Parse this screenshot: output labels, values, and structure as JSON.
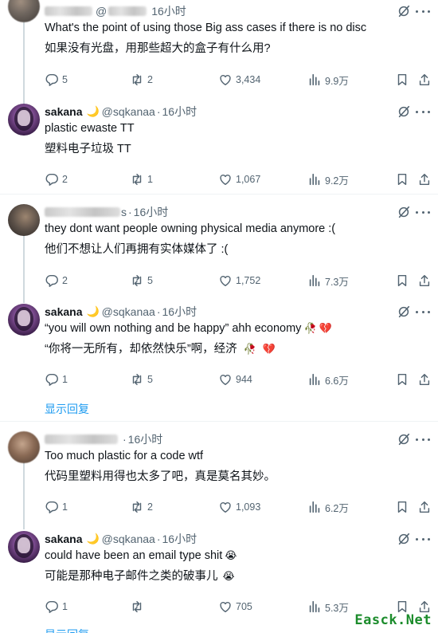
{
  "posts": [
    {
      "handle_visible": "@",
      "time": "16小时",
      "text_en": "What's the point of using those Big ass cases if there is no disc",
      "text_zh": "如果没有光盘，用那些超大的盒子有什么用?",
      "replies": "5",
      "reposts": "2",
      "likes": "3,434",
      "views": "9.9万"
    },
    {
      "name": "sakana",
      "handle": "@sqkanaa",
      "time": "16小时",
      "text_en": "plastic ewaste TT",
      "text_zh": "塑料电子垃圾 TT",
      "replies": "2",
      "reposts": "1",
      "likes": "1,067",
      "views": "9.2万"
    },
    {
      "handle_visible": "s",
      "time": "16小时",
      "text_en": "they dont want people owning physical media anymore :(",
      "text_zh": "他们不想让人们再拥有实体媒体了 :(",
      "replies": "2",
      "reposts": "5",
      "likes": "1,752",
      "views": "7.3万"
    },
    {
      "name": "sakana",
      "handle": "@sqkanaa",
      "time": "16小时",
      "text_en": "“you will own nothing and be happy” ahh economy",
      "text_zh": "“你将一无所有，却依然快乐”啊，经济",
      "replies": "1",
      "reposts": "5",
      "likes": "944",
      "views": "6.6万"
    },
    {
      "handle_visible": "",
      "time": "16小时",
      "text_en": "Too much plastic for a code wtf",
      "text_zh": "代码里塑料用得也太多了吧，真是莫名其妙。",
      "replies": "1",
      "reposts": "2",
      "likes": "1,093",
      "views": "6.2万"
    },
    {
      "name": "sakana",
      "handle": "@sqkanaa",
      "time": "16小时",
      "text_en": "could have been an email type shit",
      "text_zh": "可能是那种电子邮件之类的破事儿",
      "replies": "1",
      "reposts": "",
      "likes": "705",
      "views": "5.3万"
    }
  ],
  "show_replies_label": "显示回复",
  "dot": "·",
  "watermark": "Easck.Net",
  "icons": [
    "grok-icon",
    "more-icon",
    "reply-icon",
    "repost-icon",
    "like-icon",
    "views-icon",
    "bookmark-icon",
    "share-icon",
    "moon-icon",
    "rose-icon",
    "broken-heart-icon",
    "crying-face-icon"
  ],
  "colors": {
    "text": "#0f1419",
    "muted": "#536471",
    "link": "#1d9bf0",
    "divider": "#eff3f4",
    "thread_line": "#cfd9de",
    "watermark": "#1c8c2c"
  }
}
